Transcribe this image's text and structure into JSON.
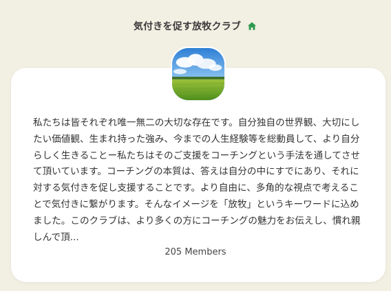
{
  "header": {
    "title": "気付きを促す放牧クラブ",
    "icon": "home-icon"
  },
  "club": {
    "avatar": "green-field-under-blue-sky-photo",
    "description": "私たちは皆それぞれ唯一無二の大切な存在です。自分独自の世界観、大切にしたい価値観、生まれ持った強み、今までの人生経験等を総動員して、より自分らしく生きることー私たちはそのご支援をコーチングという手法を通してさせて頂いています。コーチングの本質は、答えは自分の中にすでにあり、それに対する気付きを促し支援することです。より自由に、多角的な視点で考えることで気付きに繋がります。そんなイメージを「放牧」というキーワードに込めました。このクラブは、より多くの方にコーチングの魅力をお伝えし、慣れ親しんで頂...",
    "members": "205 Members"
  },
  "colors": {
    "background": "#f2efe3",
    "card": "#ffffff",
    "home_icon": "#2e9a4f",
    "text": "#333333"
  }
}
